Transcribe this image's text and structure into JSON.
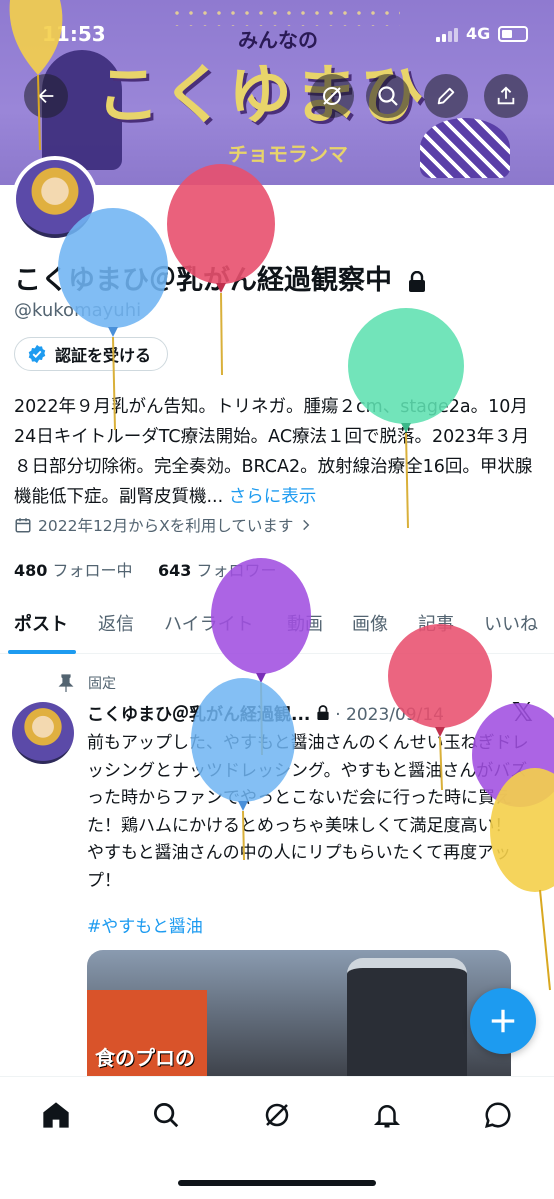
{
  "status_bar": {
    "time": "11:53",
    "network": "4G"
  },
  "banner": {
    "title_small": "みんなの",
    "title": "こくゆまひ",
    "subtitle": "チョモランマ"
  },
  "profile": {
    "name": "こくゆまひ＠乳がん経過観察中",
    "handle": "@kukomayuhi",
    "verify_label": "認証を受ける",
    "bio": "2022年９月乳がん告知。トリネガ。腫瘍２cm、stage2a。10月24日キイトルーダTC療法開始。AC療法１回で脱落。2023年３月８日部分切除術。完全奏効。BRCA2。放射線治療全16回。甲状腺機能低下症。副腎皮質機...",
    "bio_more": "さらに表示",
    "joined": "2022年12月からXを利用しています",
    "following_count": "480",
    "following_label": "フォロー中",
    "followers_count": "643",
    "followers_label": "フォロワー"
  },
  "tabs": [
    {
      "label": "ポスト"
    },
    {
      "label": "返信"
    },
    {
      "label": "ハイライト"
    },
    {
      "label": "動画"
    },
    {
      "label": "画像"
    },
    {
      "label": "記事"
    },
    {
      "label": "いいね"
    }
  ],
  "post": {
    "pinned_label": "固定",
    "author": "こくゆまひ＠乳がん経過観...",
    "date": "2023/09/14",
    "text": "前もアップした、やすもと醤油さんのくんせい玉ねぎドレッシングとナッツドレッシング。やすもと醤油さんがバズった時からファンでやっとこないだ会に行った時に買えた！鶏ハムにかけるとめっちゃ美味しくて満足度高い！\nやすもと醤油さんの中の人にリプもらいたくて再度アップ！",
    "hashtag": "#やすもと醤油",
    "media_caption": "食のプロの"
  },
  "colors": {
    "accent": "#1d9bf0",
    "banner": "#9a86d8",
    "balloon_blue": "#6fb4f2",
    "balloon_red": "#e8506e",
    "balloon_green": "#5fe0b0",
    "balloon_purple": "#a04ee0",
    "balloon_yellow": "#f4cf4a"
  },
  "icons": {
    "back": "arrow-left-icon",
    "grok": "grok-icon",
    "search": "search-icon",
    "edit": "pencil-icon",
    "share": "share-icon",
    "lock": "lock-icon",
    "calendar": "calendar-icon",
    "pin": "pin-icon",
    "compose": "plus-icon",
    "nav": [
      "home-icon",
      "search-icon",
      "grok-icon",
      "bell-icon",
      "message-icon"
    ]
  }
}
